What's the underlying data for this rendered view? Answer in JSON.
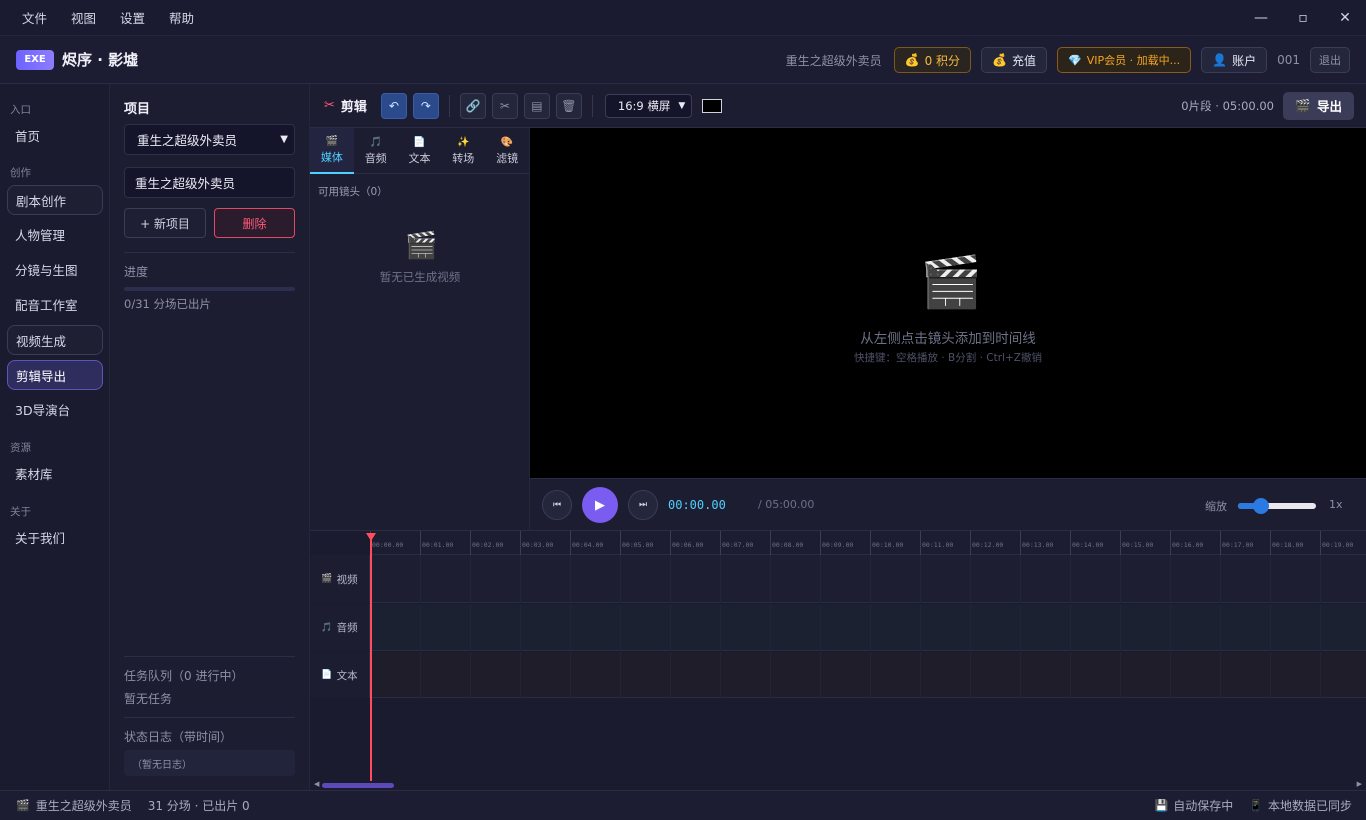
{
  "menu": [
    "文件",
    "视图",
    "设置",
    "帮助"
  ],
  "window_controls": {
    "minimize": "—",
    "maximize": "▫",
    "close": "✕"
  },
  "header": {
    "badge": "EXE",
    "title": "烬序 · 影墟",
    "user": "重生之超级外卖员",
    "points": "0 积分",
    "recharge": "充值",
    "vip": "VIP会员 · 加载中...",
    "account": "账户",
    "user_no": "001",
    "logout": "退出"
  },
  "nav": {
    "sections": {
      "entry": "入口",
      "create": "创作",
      "resources": "资源",
      "about": "关于"
    },
    "items": {
      "home": "首页",
      "script": "剧本创作",
      "characters": "人物管理",
      "storyboard": "分镜与生图",
      "dubbing": "配音工作室",
      "video": "视频生成",
      "edit": "剪辑导出",
      "director3d": "3D导演台",
      "library": "素材库",
      "about_us": "关于我们"
    }
  },
  "project": {
    "title": "项目",
    "selected": "重生之超级外卖员",
    "name_value": "重生之超级外卖员",
    "new_btn": "+ 新项目",
    "delete_btn": "删除",
    "progress_label": "进度",
    "progress_text": "0/31 分场已出片",
    "progress_fraction": 0,
    "queue_label": "任务队列（0 进行中）",
    "queue_empty": "暂无任务",
    "log_label": "状态日志（带时间）",
    "log_empty": "（暂无日志）"
  },
  "editor": {
    "title": "剪辑",
    "aspect": "16:9 横屏",
    "segments": "0片段 · 05:00.00",
    "export": "导出"
  },
  "media": {
    "tabs": [
      {
        "icon": "🎬",
        "label": "媒体"
      },
      {
        "icon": "🎵",
        "label": "音频"
      },
      {
        "icon": "📄",
        "label": "文本"
      },
      {
        "icon": "✨",
        "label": "转场"
      },
      {
        "icon": "🎨",
        "label": "滤镜"
      }
    ],
    "available": "可用镜头（0）",
    "empty": "暂无已生成视频"
  },
  "preview": {
    "hint": "从左侧点击镜头添加到时间线",
    "shortcuts": "快捷键：空格播放 · B分割 · Ctrl+Z撤销"
  },
  "transport": {
    "current": "00:00.00",
    "total": "/ 05:00.00",
    "zoom_label": "缩放",
    "zoom_value": "1x",
    "zoom_fraction": 0.3
  },
  "timeline": {
    "ticks": [
      "00:00.00",
      "00:01.00",
      "00:02.00",
      "00:03.00",
      "00:04.00",
      "00:05.00",
      "00:06.00",
      "00:07.00",
      "00:08.00",
      "00:09.00",
      "00:10.00",
      "00:11.00",
      "00:12.00",
      "00:13.00",
      "00:14.00",
      "00:15.00",
      "00:16.00",
      "00:17.00",
      "00:18.00",
      "00:19.00"
    ],
    "tracks": [
      {
        "icon": "🎬",
        "label": "视频"
      },
      {
        "icon": "🎵",
        "label": "音频"
      },
      {
        "icon": "📄",
        "label": "文本"
      }
    ]
  },
  "status": {
    "project": "重生之超级外卖员",
    "count": "31 分场 · 已出片 0",
    "autosave": "自动保存中",
    "sync": "本地数据已同步"
  },
  "colors": {
    "accent": "#6c63ff",
    "play": "#7b5cf0",
    "danger": "#ff5a7a",
    "playhead": "#ff4d5e",
    "timecode": "#4fd0ff"
  }
}
